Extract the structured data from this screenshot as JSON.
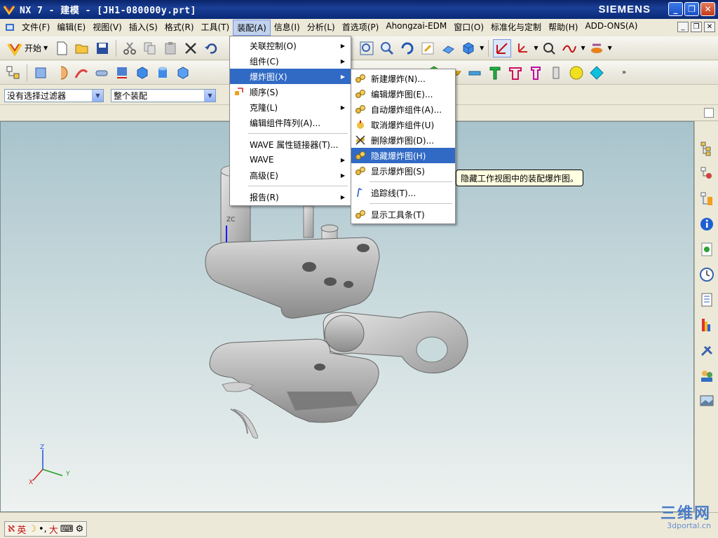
{
  "window": {
    "title": "NX 7 - 建模 - [JH1-080000y.prt]",
    "brand": "SIEMENS",
    "min_glyph": "_",
    "max_glyph": "❐",
    "close_glyph": "✕"
  },
  "menubar": {
    "items": [
      "文件(F)",
      "编辑(E)",
      "视图(V)",
      "插入(S)",
      "格式(R)",
      "工具(T)",
      "装配(A)",
      "信息(I)",
      "分析(L)",
      "首选项(P)",
      "Ahongzai-EDM",
      "窗口(O)",
      "标准化与定制",
      "帮助(H)",
      "ADD-ONS(A)"
    ],
    "active_index": 6,
    "right_buttons": [
      "_",
      "❐",
      "✕"
    ]
  },
  "toolbar1": {
    "start_label": "开始"
  },
  "filterbar": {
    "selection_filter": "没有选择过滤器",
    "assembly_scope": "整个装配"
  },
  "assembly_menu": {
    "items": [
      {
        "label": "关联控制(O)",
        "submenu": true
      },
      {
        "label": "组件(C)",
        "submenu": true
      },
      {
        "label": "爆炸图(X)",
        "submenu": true,
        "highlighted": true
      },
      {
        "label": "顺序(S)",
        "submenu": false,
        "icon": "sequence-icon"
      },
      {
        "label": "克隆(L)",
        "submenu": true
      },
      {
        "label": "编辑组件阵列(A)...",
        "submenu": false
      },
      {
        "label": "WAVE 属性链接器(T)...",
        "submenu": false
      },
      {
        "label": "WAVE",
        "submenu": true
      },
      {
        "label": "高级(E)",
        "submenu": true
      },
      {
        "label": "报告(R)",
        "submenu": true
      }
    ]
  },
  "exploded_submenu": {
    "items": [
      {
        "label": "新建爆炸(N)...",
        "icon": "new-explosion-icon"
      },
      {
        "label": "编辑爆炸图(E)...",
        "icon": "edit-explosion-icon"
      },
      {
        "label": "自动爆炸组件(A)...",
        "icon": "auto-explode-icon"
      },
      {
        "label": "取消爆炸组件(U)",
        "icon": "unexplode-icon"
      },
      {
        "label": "删除爆炸图(D)...",
        "icon": "delete-explosion-icon"
      },
      {
        "label": "隐藏爆炸图(H)",
        "icon": "hide-explosion-icon",
        "highlighted": true
      },
      {
        "label": "显示爆炸图(S)",
        "icon": "show-explosion-icon"
      },
      {
        "label": "追踪线(T)...",
        "icon": "tracelines-icon"
      },
      {
        "label": "显示工具条(T)",
        "icon": "show-toolbar-icon"
      }
    ]
  },
  "tooltip": {
    "text": "隐藏工作视图中的装配爆炸图。"
  },
  "viewport": {
    "wcs_label": "ZC",
    "axis_z": "Z",
    "axis_x": "X",
    "axis_y": "Y"
  },
  "statusbar": {
    "ime_text_1": "英",
    "ime_text_2": "大"
  },
  "watermark": {
    "line1": "三维网",
    "line2": "3dportal.cn"
  },
  "colors": {
    "menu_highlight": "#316ac5",
    "title_bar": "#0a246a",
    "viewport_top": "#a8c3cc",
    "tooltip_bg": "#ffffe1"
  }
}
